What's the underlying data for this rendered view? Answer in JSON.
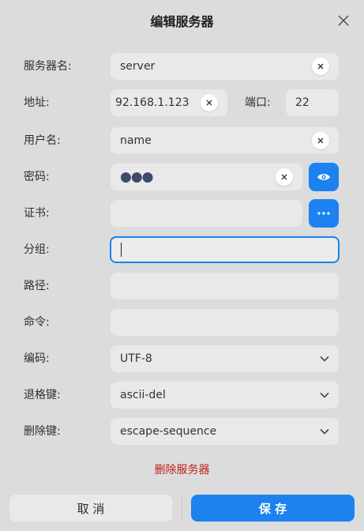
{
  "dialog": {
    "title": "编辑服务器"
  },
  "fields": {
    "server_name": {
      "label": "服务器名:",
      "value": "server"
    },
    "address": {
      "label": "地址:",
      "value": "92.168.1.123"
    },
    "port": {
      "label": "端口:",
      "value": "22"
    },
    "username": {
      "label": "用户名:",
      "value": "name"
    },
    "password": {
      "label": "密码:",
      "value": "●●●"
    },
    "certificate": {
      "label": "证书:",
      "value": ""
    },
    "group": {
      "label": "分组:",
      "value": ""
    },
    "path": {
      "label": "路径:",
      "value": ""
    },
    "command": {
      "label": "命令:",
      "value": ""
    },
    "encoding": {
      "label": "编码:",
      "value": "UTF-8"
    },
    "backspace_key": {
      "label": "退格键:",
      "value": "ascii-del"
    },
    "delete_key": {
      "label": "删除键:",
      "value": "escape-sequence"
    }
  },
  "actions": {
    "delete_server": "删除服务器",
    "cancel": "取 消",
    "save": "保 存"
  },
  "colors": {
    "accent": "#1b82f0",
    "danger": "#c0211e",
    "background": "#dcdcdc",
    "field": "#e9e9e9"
  },
  "icons": {
    "close": "close-icon",
    "clear": "clear-icon",
    "eye": "eye-icon",
    "more": "more-icon",
    "chevron": "chevron-down-icon"
  }
}
